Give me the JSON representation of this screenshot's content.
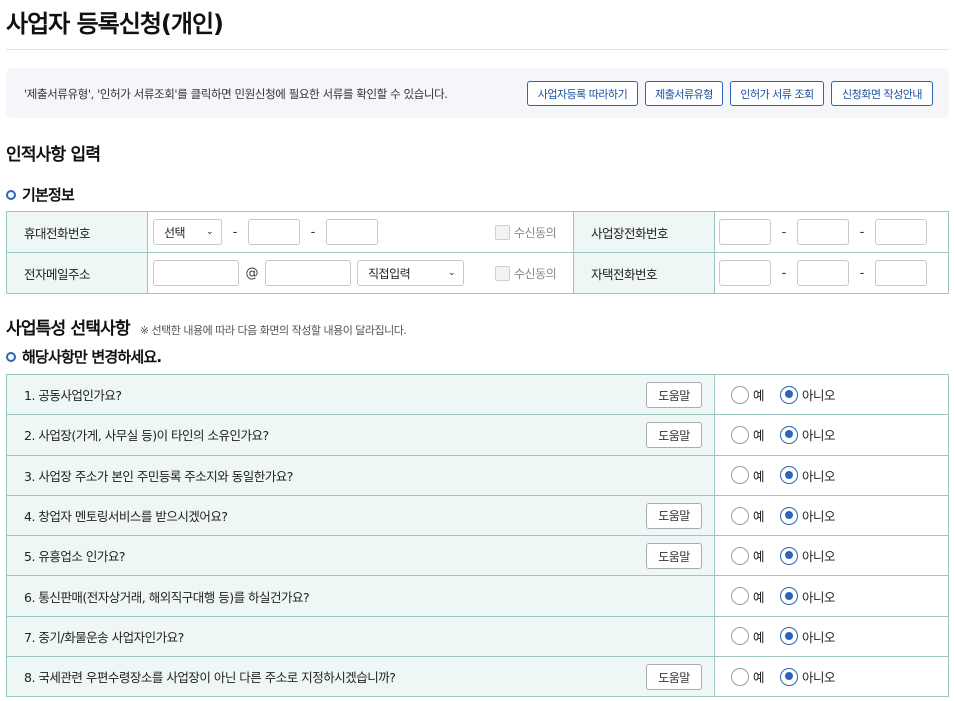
{
  "page": {
    "title": "사업자 등록신청(개인)"
  },
  "notice": {
    "text": "'제출서류유형', '인허가 서류조회'를 클릭하면 민원신청에 필요한 서류를 확인할 수 있습니다.",
    "buttons": [
      "사업자등록 따라하기",
      "제출서류유형",
      "인허가 서류 조회",
      "신청화면 작성안내"
    ]
  },
  "personal": {
    "heading": "인적사항 입력",
    "basic_heading": "기본정보",
    "mobile_label": "휴대전화번호",
    "mobile_select": "선택",
    "dash": "-",
    "consent": "수신동의",
    "biz_phone_label": "사업장전화번호",
    "email_label": "전자메일주소",
    "at": "@",
    "email_domain_select": "직접입력",
    "home_phone_label": "자택전화번호"
  },
  "biz": {
    "heading": "사업특성 선택사항",
    "heading_note": "※ 선택한 내용에 따라 다음 화면의 작성할 내용이 달라집니다.",
    "sub_heading": "해당사항만 변경하세요.",
    "help_label": "도움말",
    "yes_label": "예",
    "no_label": "아니오",
    "questions": [
      "1. 공동사업인가요?",
      "2. 사업장(가게, 사무실 등)이 타인의 소유인가요?",
      "3. 사업장 주소가 본인 주민등록 주소지와 동일한가요?",
      "4. 창업자 멘토링서비스를 받으시겠어요?",
      "5. 유흥업소 인가요?",
      "6. 통신판매(전자상거래, 해외직구대행 등)를 하실건가요?",
      "7. 중기/화물운송 사업자인가요?",
      "8. 국세관련 우편수령장소를 사업장이 아닌 다른 주소로 지정하시겠습니까?"
    ],
    "selected": [
      "아니오",
      "아니오",
      "아니오",
      "아니오",
      "아니오",
      "아니오",
      "아니오",
      "아니오"
    ]
  },
  "colors": {
    "accent": "#2b64b9",
    "header_bg": "#eef7f5",
    "border": "#9cc7c1"
  }
}
